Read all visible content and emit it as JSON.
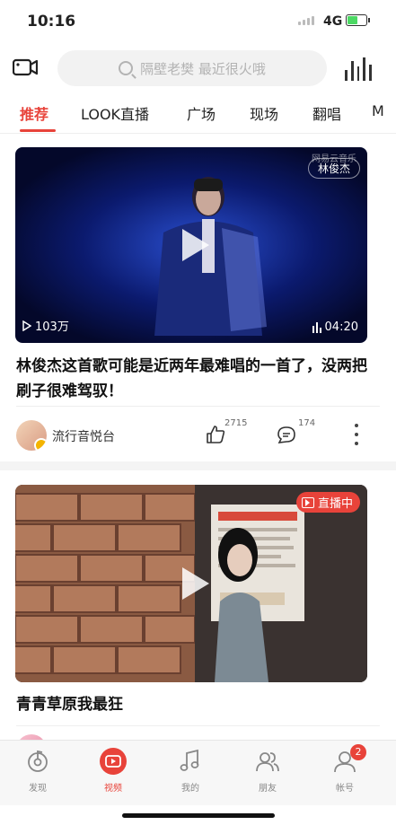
{
  "status_bar": {
    "time": "10:16",
    "network": "4G"
  },
  "search": {
    "placeholder": "隔壁老樊 最近很火哦"
  },
  "tabs": [
    {
      "label": "推荐",
      "active": true
    },
    {
      "label": "LOOK直播"
    },
    {
      "label": "广场"
    },
    {
      "label": "现场"
    },
    {
      "label": "翻唱"
    },
    {
      "label": "M"
    }
  ],
  "feed": [
    {
      "tag": "林俊杰",
      "watermark": "网易云音乐",
      "views": "103万",
      "duration": "04:20",
      "title": "林俊杰这首歌可能是近两年最难唱的一首了，没两把刷子很难驾驭！",
      "author": "流行音悦台",
      "likes": "2715",
      "comments": "174"
    },
    {
      "live_label": "直播中",
      "title": "青青草原我最狂"
    }
  ],
  "bottom_nav": [
    {
      "label": "发现",
      "icon": "discover-icon"
    },
    {
      "label": "视频",
      "icon": "video-icon",
      "active": true
    },
    {
      "label": "我的",
      "icon": "music-note-icon"
    },
    {
      "label": "朋友",
      "icon": "friends-icon"
    },
    {
      "label": "帐号",
      "icon": "account-icon",
      "badge": "2"
    }
  ],
  "colors": {
    "accent": "#e8433a",
    "nav_bg": "#f7f7f7"
  }
}
